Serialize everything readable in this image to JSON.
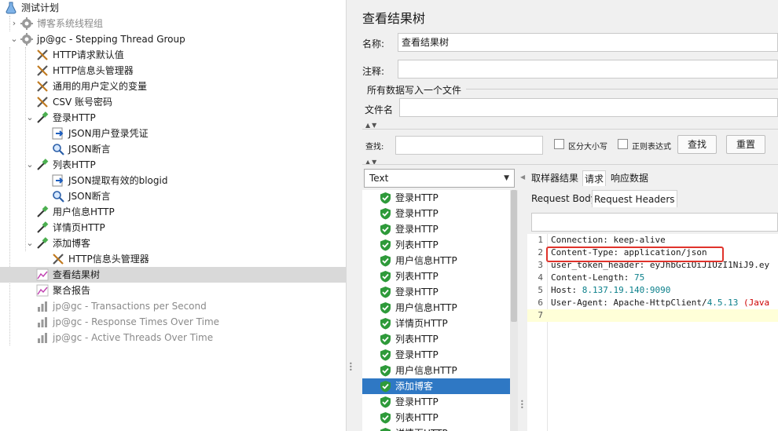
{
  "tree": {
    "items": [
      {
        "label": "测试计划",
        "icon": "flask-icon",
        "gray": false
      },
      {
        "label": "博客系统线程组",
        "icon": "gear-icon",
        "gray": true
      },
      {
        "label": "jp@gc - Stepping Thread Group",
        "icon": "gear-icon",
        "gray": false
      },
      {
        "label": "HTTP请求默认值",
        "icon": "wrench-icon",
        "gray": false
      },
      {
        "label": "HTTP信息头管理器",
        "icon": "wrench-icon",
        "gray": false
      },
      {
        "label": "通用的用户定义的变量",
        "icon": "wrench-icon",
        "gray": false
      },
      {
        "label": "CSV 账号密码",
        "icon": "wrench-icon",
        "gray": false
      },
      {
        "label": "登录HTTP",
        "icon": "pipette-icon",
        "gray": false
      },
      {
        "label": "JSON用户登录凭证",
        "icon": "extractor-icon",
        "gray": false
      },
      {
        "label": "JSON断言",
        "icon": "magnifier-icon",
        "gray": false
      },
      {
        "label": "列表HTTP",
        "icon": "pipette-icon",
        "gray": false
      },
      {
        "label": "JSON提取有效的blogid",
        "icon": "extractor-icon",
        "gray": false
      },
      {
        "label": "JSON断言",
        "icon": "magnifier-icon",
        "gray": false
      },
      {
        "label": "用户信息HTTP",
        "icon": "pipette-icon",
        "gray": false
      },
      {
        "label": "详情页HTTP",
        "icon": "pipette-icon",
        "gray": false
      },
      {
        "label": "添加博客",
        "icon": "pipette-icon",
        "gray": false
      },
      {
        "label": "HTTP信息头管理器",
        "icon": "wrench-icon",
        "gray": false
      },
      {
        "label": "查看结果树",
        "icon": "graph-icon",
        "gray": false
      },
      {
        "label": "聚合报告",
        "icon": "graph-icon",
        "gray": false
      },
      {
        "label": "jp@gc - Transactions per Second",
        "icon": "bar-graph-icon",
        "gray": true
      },
      {
        "label": "jp@gc - Response Times Over Time",
        "icon": "bar-graph-icon",
        "gray": true
      },
      {
        "label": "jp@gc - Active Threads Over Time",
        "icon": "bar-graph-icon",
        "gray": true
      }
    ]
  },
  "panel": {
    "title": "查看结果树",
    "name_label": "名称:",
    "name_value": "查看结果树",
    "comment_label": "注释:",
    "comment_value": "",
    "file_section": "所有数据写入一个文件",
    "file_label": "文件名",
    "file_value": "",
    "search_label": "查找:",
    "search_value": "",
    "case_sensitive": "区分大小写",
    "regex": "正则表达式",
    "find_button": "查找",
    "reset_button": "重置"
  },
  "results": {
    "renderer": "Text",
    "rows": [
      {
        "label": "登录HTTP",
        "selected": false
      },
      {
        "label": "登录HTTP",
        "selected": false
      },
      {
        "label": "登录HTTP",
        "selected": false
      },
      {
        "label": "列表HTTP",
        "selected": false
      },
      {
        "label": "用户信息HTTP",
        "selected": false
      },
      {
        "label": "列表HTTP",
        "selected": false
      },
      {
        "label": "登录HTTP",
        "selected": false
      },
      {
        "label": "用户信息HTTP",
        "selected": false
      },
      {
        "label": "详情页HTTP",
        "selected": false
      },
      {
        "label": "列表HTTP",
        "selected": false
      },
      {
        "label": "登录HTTP",
        "selected": false
      },
      {
        "label": "用户信息HTTP",
        "selected": false
      },
      {
        "label": "添加博客",
        "selected": true
      },
      {
        "label": "登录HTTP",
        "selected": false
      },
      {
        "label": "列表HTTP",
        "selected": false
      },
      {
        "label": "详情页HTTP",
        "selected": false
      }
    ]
  },
  "detail": {
    "tabs": [
      "取样器结果",
      "请求",
      "响应数据"
    ],
    "active_tab": "请求",
    "subtabs": [
      "Request Body",
      "Request Headers"
    ],
    "active_subtab": "Request Headers",
    "lines": [
      {
        "num": "1",
        "text": "Connection: keep-alive"
      },
      {
        "num": "2",
        "text": "Content-Type: application/json"
      },
      {
        "num": "3",
        "text": "user_token_header: eyJhbGciOiJIUzI1NiJ9.ey"
      },
      {
        "num": "4",
        "key": "Content-Length: ",
        "value": "75"
      },
      {
        "num": "5",
        "key": "Host: ",
        "value": "8.137.19.140:9090"
      },
      {
        "num": "6",
        "key": "User-Agent: Apache-HttpClient/",
        "value": "4.5.13",
        "rest": " (Java"
      },
      {
        "num": "7",
        "text": ""
      }
    ]
  },
  "colors": {
    "selection_blue": "#2f78c4",
    "highlight_red": "#e0332b",
    "shield_green": "#2e9a3a"
  }
}
